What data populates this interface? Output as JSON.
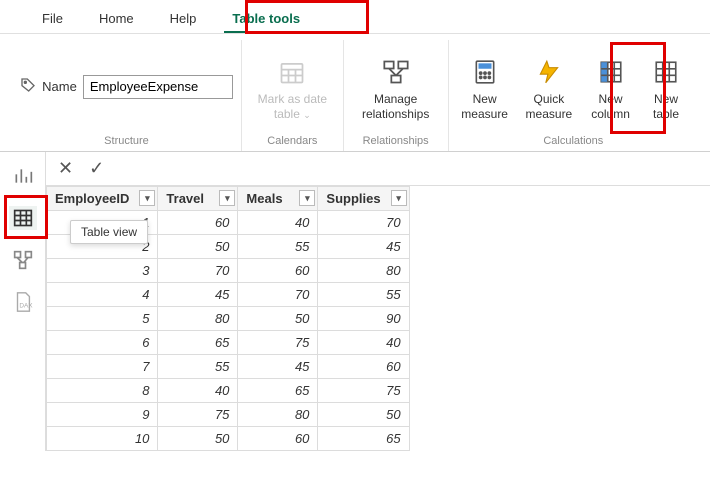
{
  "tabs": {
    "file": "File",
    "home": "Home",
    "help": "Help",
    "tabletools": "Table tools"
  },
  "ribbon": {
    "structure": {
      "label": "Structure",
      "name_label": "Name",
      "name_value": "EmployeeExpense"
    },
    "calendars": {
      "label": "Calendars",
      "mark_as_date": "Mark as date table"
    },
    "relationships": {
      "label": "Relationships",
      "manage": "Manage relationships"
    },
    "calculations": {
      "label": "Calculations",
      "new_measure": "New measure",
      "quick_measure": "Quick measure",
      "new_column": "New column",
      "new_table": "New table"
    }
  },
  "tooltip": "Table view",
  "formula_value": "",
  "table": {
    "columns": [
      "EmployeeID",
      "Travel",
      "Meals",
      "Supplies"
    ],
    "rows": [
      {
        "EmployeeID": 1,
        "Travel": 60,
        "Meals": 40,
        "Supplies": 70
      },
      {
        "EmployeeID": 2,
        "Travel": 50,
        "Meals": 55,
        "Supplies": 45
      },
      {
        "EmployeeID": 3,
        "Travel": 70,
        "Meals": 60,
        "Supplies": 80
      },
      {
        "EmployeeID": 4,
        "Travel": 45,
        "Meals": 70,
        "Supplies": 55
      },
      {
        "EmployeeID": 5,
        "Travel": 80,
        "Meals": 50,
        "Supplies": 90
      },
      {
        "EmployeeID": 6,
        "Travel": 65,
        "Meals": 75,
        "Supplies": 40
      },
      {
        "EmployeeID": 7,
        "Travel": 55,
        "Meals": 45,
        "Supplies": 60
      },
      {
        "EmployeeID": 8,
        "Travel": 40,
        "Meals": 65,
        "Supplies": 75
      },
      {
        "EmployeeID": 9,
        "Travel": 75,
        "Meals": 80,
        "Supplies": 50
      },
      {
        "EmployeeID": 10,
        "Travel": 50,
        "Meals": 60,
        "Supplies": 65
      }
    ]
  }
}
